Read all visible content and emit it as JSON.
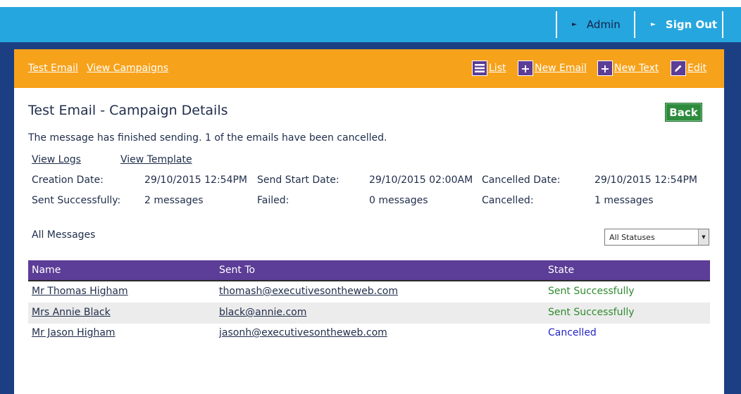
{
  "topnav": {
    "admin_label": "Admin",
    "signout_label": "Sign Out"
  },
  "subnav": {
    "links": [
      "Test Email",
      "View Campaigns"
    ],
    "actions": [
      {
        "icon": "list-icon",
        "label": "List"
      },
      {
        "icon": "plus-icon",
        "label": "New Email"
      },
      {
        "icon": "plus-icon",
        "label": "New Text"
      },
      {
        "icon": "pencil-icon",
        "label": "Edit"
      }
    ]
  },
  "page": {
    "title": "Test Email - Campaign Details",
    "back_label": "Back",
    "status_message": "The message has finished sending. 1 of the emails have been cancelled.",
    "view_logs": "View Logs",
    "view_template": "View Template"
  },
  "details": {
    "creation_date_label": "Creation Date:",
    "creation_date": "29/10/2015 12:54PM",
    "send_start_label": "Send Start Date:",
    "send_start": "29/10/2015 02:00AM",
    "cancelled_date_label": "Cancelled Date:",
    "cancelled_date": "29/10/2015 12:54PM",
    "sent_ok_label": "Sent Successfully:",
    "sent_ok": "2 messages",
    "failed_label": "Failed:",
    "failed": "0 messages",
    "cancelled_label": "Cancelled:",
    "cancelled": "1 messages"
  },
  "messages": {
    "heading": "All Messages",
    "filter_value": "All Statuses",
    "columns": [
      "Name",
      "Sent To",
      "State"
    ],
    "rows": [
      {
        "name": "Mr Thomas Higham",
        "to": "thomash@executivesontheweb.com",
        "state": "Sent Successfully"
      },
      {
        "name": "Mrs Annie Black",
        "to": "black@annie.com",
        "state": "Sent Successfully"
      },
      {
        "name": "Mr Jason Higham",
        "to": "jasonh@executivesontheweb.com",
        "state": "Cancelled"
      }
    ]
  },
  "colors": {
    "topbar": "#26a6de",
    "frame": "#1c3f84",
    "subnav": "#f7a21b",
    "accent_purple": "#5c3d97",
    "back_green": "#2e8b3d",
    "state_ok": "#2e8b2e",
    "state_cancelled": "#2525c8"
  }
}
